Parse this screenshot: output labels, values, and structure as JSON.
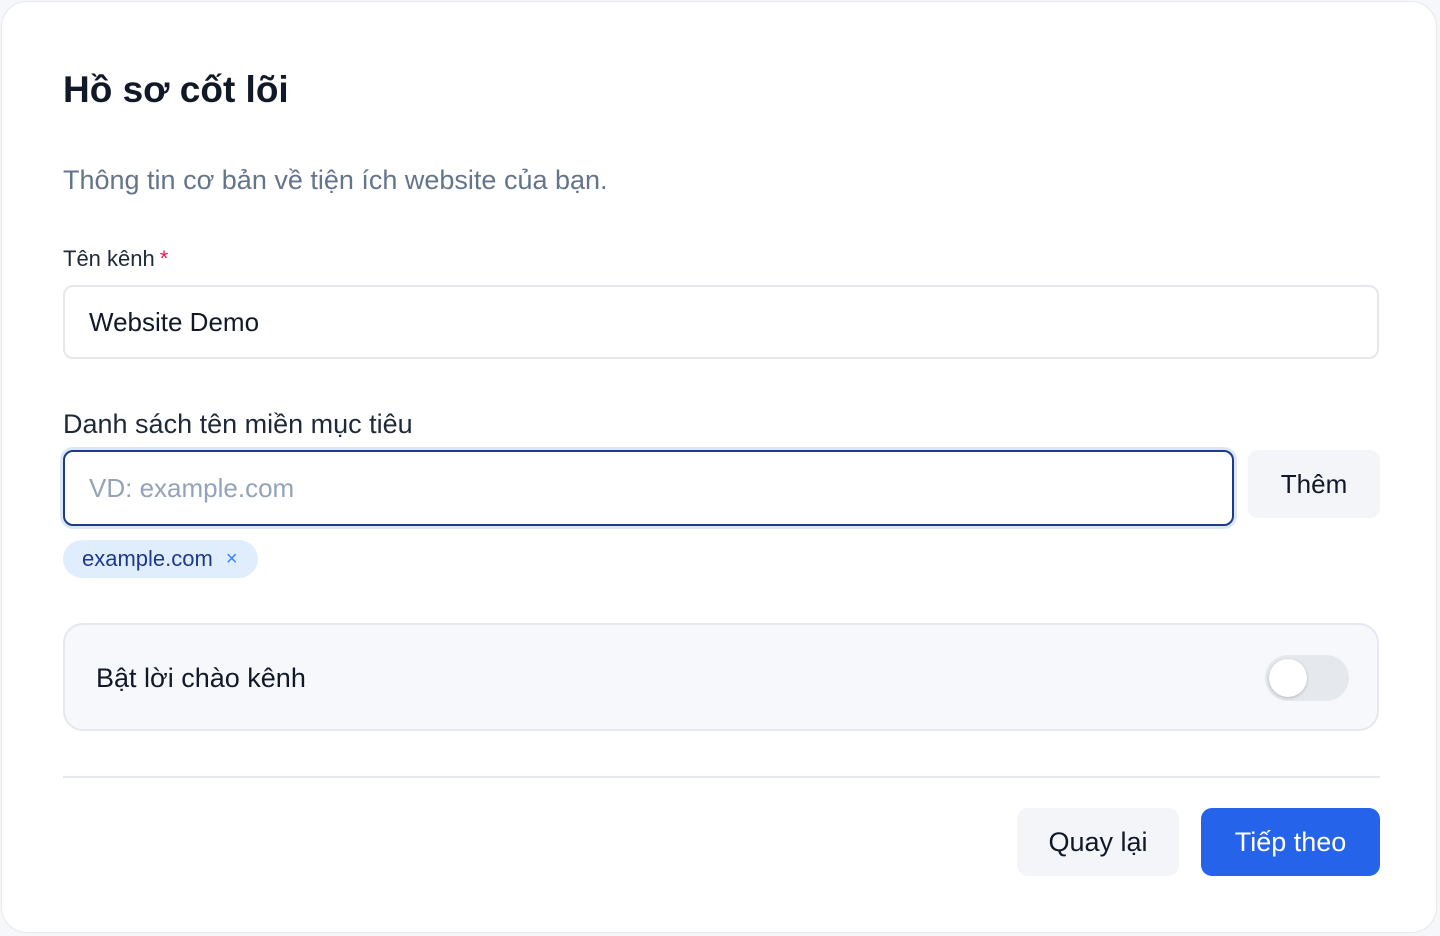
{
  "header": {
    "title": "Hồ sơ cốt lõi",
    "subtitle": "Thông tin cơ bản về tiện ích website của bạn."
  },
  "channel_name": {
    "label": "Tên kênh",
    "required_marker": "*",
    "value": "Website Demo"
  },
  "domains": {
    "label": "Danh sách tên miền mục tiêu",
    "placeholder": "VD: example.com",
    "value": "",
    "add_label": "Thêm",
    "items": [
      {
        "label": "example.com",
        "remove_symbol": "×"
      }
    ]
  },
  "greeting": {
    "label": "Bật lời chào kênh",
    "enabled": false
  },
  "footer": {
    "back_label": "Quay lại",
    "next_label": "Tiếp theo"
  },
  "colors": {
    "primary": "#2563eb",
    "focus_border": "#1e3a8a",
    "required": "#e11d48",
    "chip_background": "#e0edfc",
    "chip_text": "#1e3a8a"
  }
}
